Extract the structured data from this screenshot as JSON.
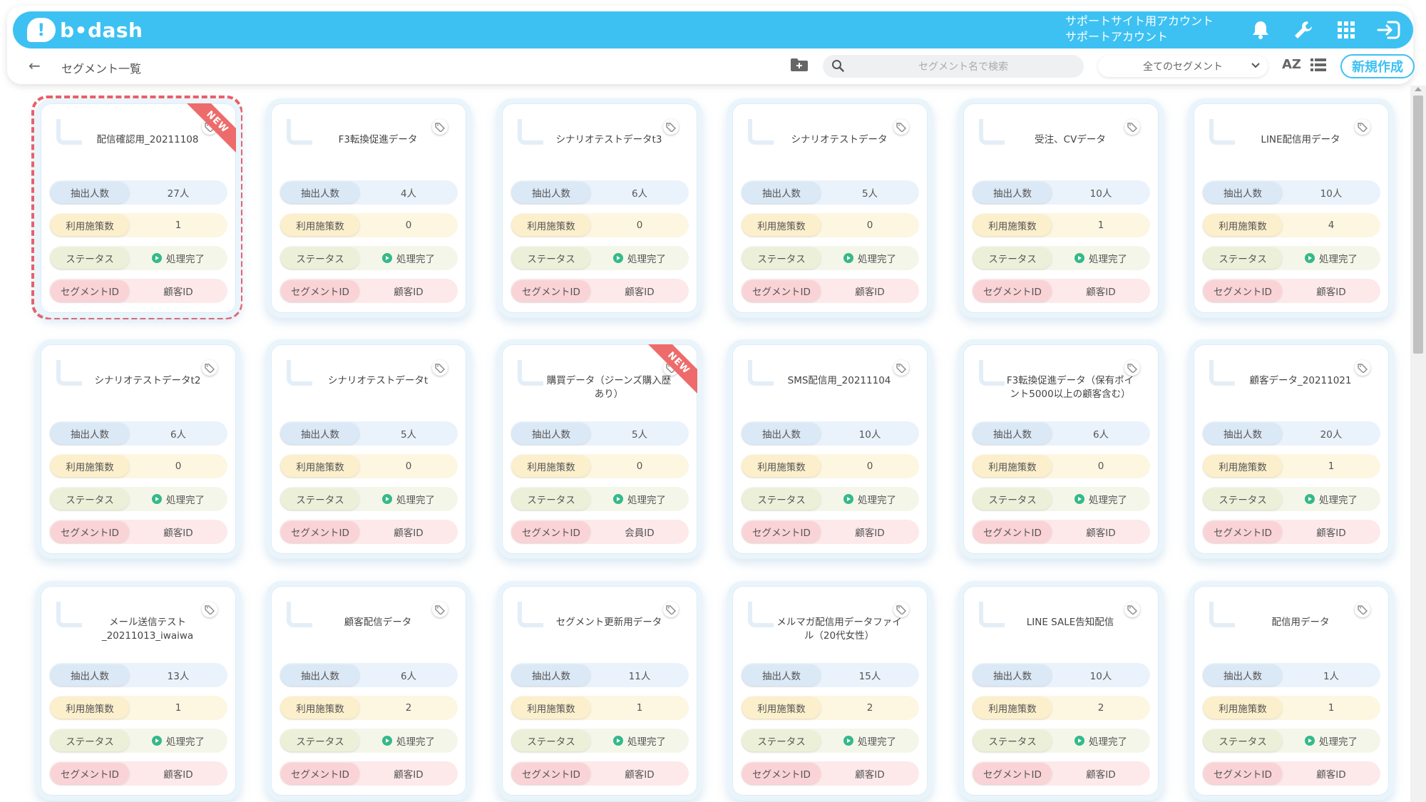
{
  "header": {
    "logo_text": "b•dash",
    "account_line1": "サポートサイト用アカウント",
    "account_line2": "サポートアカウント",
    "icons": [
      "bell-icon",
      "wrench-icon",
      "grid-icon",
      "logout-icon"
    ]
  },
  "subbar": {
    "page_title": "セグメント一覧",
    "search_placeholder": "セグメント名で検索",
    "filter_selected": "全てのセグメント",
    "sort_label": "AZ",
    "new_button": "新規作成"
  },
  "labels": {
    "extract": "抽出人数",
    "used": "利用施策数",
    "status": "ステータス",
    "segment_id": "セグメントID"
  },
  "badge": "NEW",
  "colors": {
    "accent": "#3dc1f2",
    "new_ribbon": "#ee6b6b",
    "done": "#35b98a"
  },
  "cards": [
    {
      "title": "配信確認用_20211108",
      "count": "27人",
      "used": "1",
      "status": "処理完了",
      "id_type": "顧客ID",
      "new": true,
      "highlight": true
    },
    {
      "title": "F3転換促進データ",
      "count": "4人",
      "used": "0",
      "status": "処理完了",
      "id_type": "顧客ID"
    },
    {
      "title": "シナリオテストデータt3",
      "count": "6人",
      "used": "0",
      "status": "処理完了",
      "id_type": "顧客ID"
    },
    {
      "title": "シナリオテストデータ",
      "count": "5人",
      "used": "0",
      "status": "処理完了",
      "id_type": "顧客ID"
    },
    {
      "title": "受注、CVデータ",
      "count": "10人",
      "used": "1",
      "status": "処理完了",
      "id_type": "顧客ID"
    },
    {
      "title": "LINE配信用データ",
      "count": "10人",
      "used": "4",
      "status": "処理完了",
      "id_type": "顧客ID"
    },
    {
      "title": "シナリオテストデータt2",
      "count": "6人",
      "used": "0",
      "status": "処理完了",
      "id_type": "顧客ID"
    },
    {
      "title": "シナリオテストデータt",
      "count": "5人",
      "used": "0",
      "status": "処理完了",
      "id_type": "顧客ID"
    },
    {
      "title": "購買データ（ジーンズ購入歴あり）",
      "count": "5人",
      "used": "0",
      "status": "処理完了",
      "id_type": "会員ID",
      "new": true
    },
    {
      "title": "SMS配信用_20211104",
      "count": "10人",
      "used": "0",
      "status": "処理完了",
      "id_type": "顧客ID"
    },
    {
      "title": "F3転換促進データ（保有ポイント5000以上の顧客含む）",
      "count": "6人",
      "used": "0",
      "status": "処理完了",
      "id_type": "顧客ID"
    },
    {
      "title": "顧客データ_20211021",
      "count": "20人",
      "used": "1",
      "status": "処理完了",
      "id_type": "顧客ID"
    },
    {
      "title": "メール送信テスト_20211013_iwaiwa",
      "count": "13人",
      "used": "1",
      "status": "処理完了",
      "id_type": "顧客ID"
    },
    {
      "title": "顧客配信データ",
      "count": "6人",
      "used": "2",
      "status": "処理完了",
      "id_type": "顧客ID"
    },
    {
      "title": "セグメント更新用データ",
      "count": "11人",
      "used": "1",
      "status": "処理完了",
      "id_type": "顧客ID"
    },
    {
      "title": "メルマガ配信用データファイル（20代女性）",
      "count": "15人",
      "used": "2",
      "status": "処理完了",
      "id_type": "顧客ID"
    },
    {
      "title": "LINE SALE告知配信",
      "count": "10人",
      "used": "2",
      "status": "処理完了",
      "id_type": "顧客ID"
    },
    {
      "title": "配信用データ",
      "count": "1人",
      "used": "1",
      "status": "処理完了",
      "id_type": "顧客ID"
    }
  ]
}
